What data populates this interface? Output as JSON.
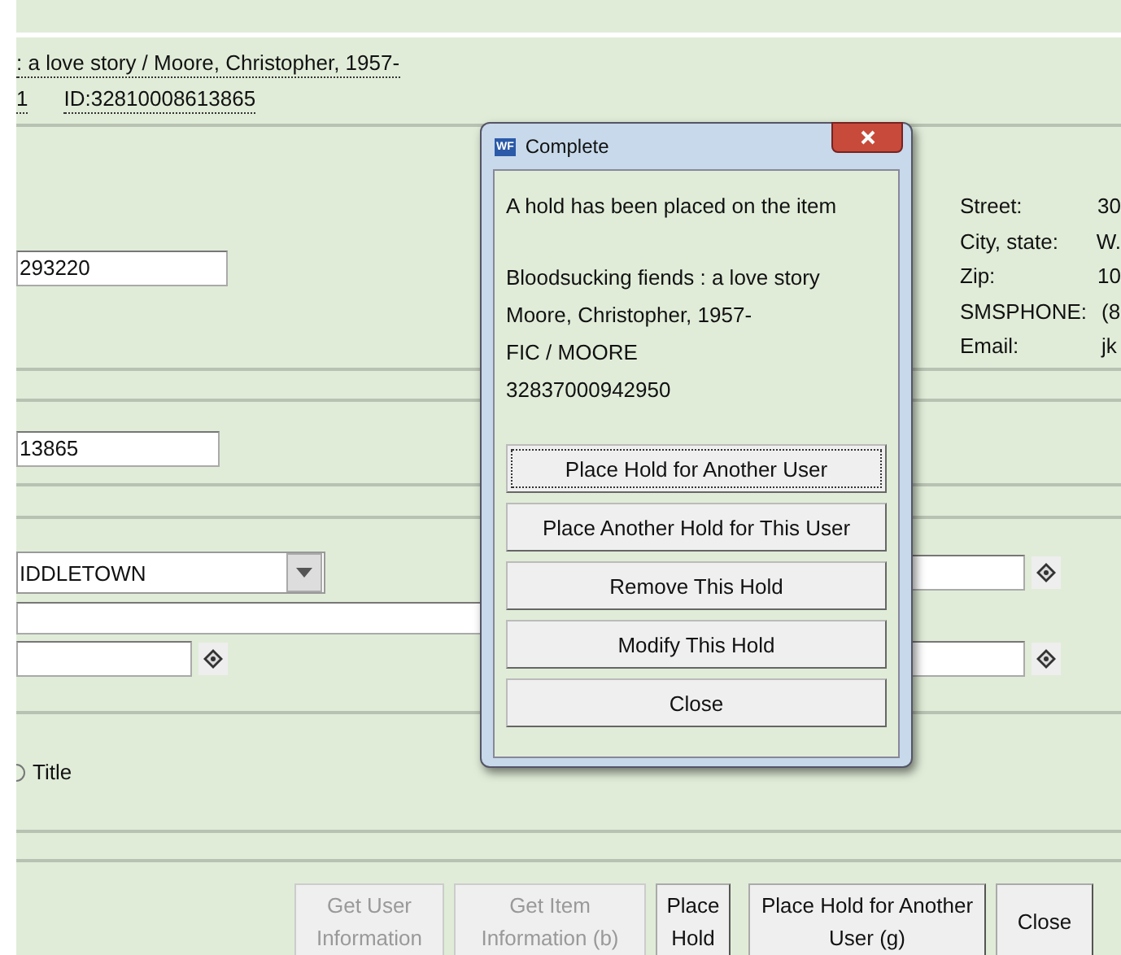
{
  "record": {
    "title_line": ": a love story / Moore, Christopher, 1957-",
    "copy": "1",
    "id": "ID:32810008613865"
  },
  "user_id_field": {
    "value": "293220"
  },
  "address": [
    {
      "label": "Street:",
      "value": "30"
    },
    {
      "label": "City, state:",
      "value": "W."
    },
    {
      "label": "Zip:",
      "value": "10"
    },
    {
      "label": "SMSPHONE:",
      "value": "(8"
    },
    {
      "label": "Email:",
      "value": "jk"
    }
  ],
  "item_id_field": {
    "value": "13865"
  },
  "library_select": {
    "value": "IDDLETOWN"
  },
  "search_by": {
    "label": "Title"
  },
  "actions": [
    {
      "label": "Get User Information",
      "disabled": true
    },
    {
      "label": "Get Item Information (b)",
      "disabled": true
    },
    {
      "label": "Place Hold",
      "disabled": false
    },
    {
      "label": "Place Hold for Another User (g)",
      "disabled": false
    },
    {
      "label": "Close",
      "disabled": false
    }
  ],
  "dialog": {
    "title": "Complete",
    "app_icon": "WF",
    "message": "A hold has been placed on the item",
    "details": [
      "Bloodsucking fiends : a love story",
      "Moore, Christopher, 1957-",
      "FIC / MOORE",
      "32837000942950"
    ],
    "buttons": [
      {
        "label": "Place Hold for Another User",
        "focused": true
      },
      {
        "label": "Place Another Hold for This User",
        "focused": false
      },
      {
        "label": "Remove This Hold",
        "focused": false
      },
      {
        "label": "Modify This Hold",
        "focused": false
      },
      {
        "label": "Close",
        "focused": false
      }
    ]
  }
}
